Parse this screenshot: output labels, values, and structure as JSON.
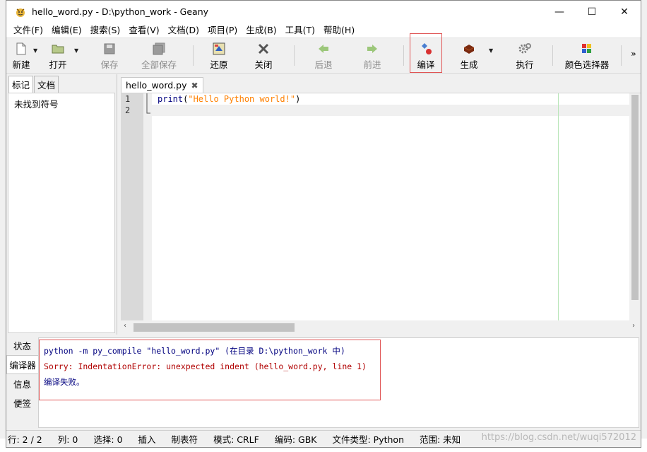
{
  "window": {
    "title": "hello_word.py - D:\\python_work - Geany",
    "controls": {
      "minimize": "—",
      "maximize": "☐",
      "close": "✕"
    }
  },
  "menu": [
    "文件(F)",
    "编辑(E)",
    "搜索(S)",
    "查看(V)",
    "文档(D)",
    "项目(P)",
    "生成(B)",
    "工具(T)",
    "帮助(H)"
  ],
  "toolbar": {
    "new": "新建",
    "open": "打开",
    "save": "保存",
    "save_all": "全部保存",
    "revert": "还原",
    "close": "关闭",
    "back": "后退",
    "forward": "前进",
    "compile": "编译",
    "build": "生成",
    "execute": "执行",
    "color_picker": "颜色选择器",
    "more": "»"
  },
  "sidebar": {
    "tabs": [
      "标记",
      "文档"
    ],
    "empty_text": "未找到符号"
  },
  "editor": {
    "tab_label": "hello_word.py",
    "line_numbers": [
      "1",
      "2"
    ],
    "code": {
      "keyword": "print",
      "open": "(",
      "string": "\"Hello Python world!\"",
      "close": ")"
    }
  },
  "messages": {
    "tabs": [
      "状态",
      "编译器",
      "信息",
      "便签"
    ],
    "lines": [
      "python -m py_compile \"hello_word.py\" (在目录 D:\\python_work 中)",
      "Sorry: IndentationError: unexpected indent (hello_word.py, line 1)",
      "编译失败。"
    ],
    "colors": {
      "cmd": "#00007f",
      "error": "#b00000",
      "fail": "#00007f"
    }
  },
  "status": {
    "line": "行: 2 / 2",
    "col": "列: 0",
    "sel": "选择: 0",
    "ins": "插入",
    "tab": "制表符",
    "mode": "模式: CRLF",
    "enc": "编码: GBK",
    "ftype": "文件类型: Python",
    "scope": "范围: 未知"
  },
  "watermark": "https://blog.csdn.net/wuqi572012"
}
